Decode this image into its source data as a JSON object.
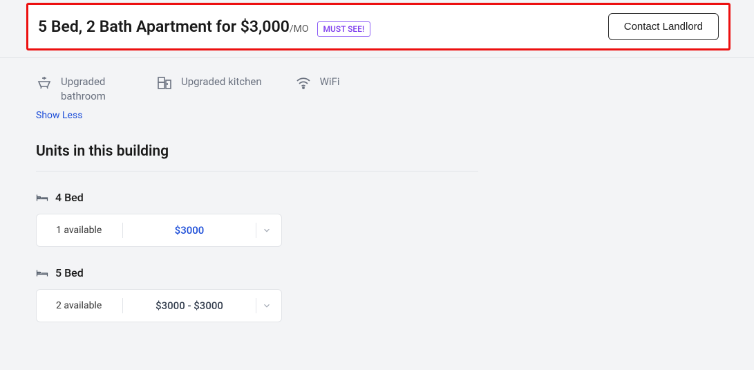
{
  "header": {
    "title": "5 Bed, 2 Bath Apartment for $3,000",
    "suffix": "/MO",
    "badge": "MUST SEE!",
    "contact_label": "Contact Landlord"
  },
  "amenities": [
    {
      "icon": "bathroom",
      "label": "Upgraded bathroom"
    },
    {
      "icon": "kitchen",
      "label": "Upgraded kitchen"
    },
    {
      "icon": "wifi",
      "label": "WiFi"
    }
  ],
  "show_less_label": "Show Less",
  "units_heading": "Units in this building",
  "bed_groups": [
    {
      "label": "4 Bed",
      "available": "1 available",
      "price": "$3000",
      "price_color": "blue"
    },
    {
      "label": "5 Bed",
      "available": "2 available",
      "price": "$3000 - $3000",
      "price_color": "gray"
    }
  ]
}
